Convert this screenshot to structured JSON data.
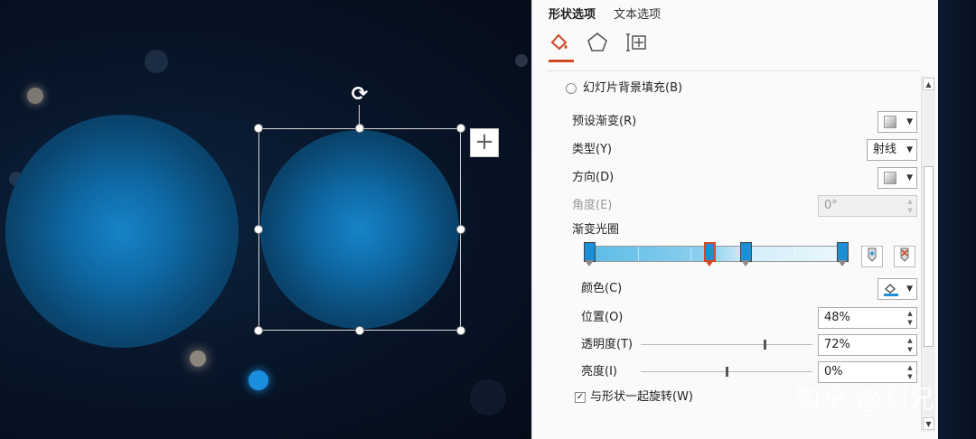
{
  "panel": {
    "tabs": [
      {
        "label": "形状选项",
        "active": true
      },
      {
        "label": "文本选项",
        "active": false
      }
    ],
    "icons": [
      "fill-bucket-icon",
      "pentagon-icon",
      "size-properties-icon"
    ],
    "slide_bg_fill_label": "幻灯片背景填充(B)",
    "preset_gradient_label": "预设渐变(R)",
    "type_label": "类型(Y)",
    "type_value": "射线",
    "direction_label": "方向(D)",
    "angle_label": "角度(E)",
    "angle_value": "0°",
    "gradient_stops_label": "渐变光圈",
    "gradient_stops": [
      0.02,
      0.48,
      0.62,
      0.99
    ],
    "selected_stop_index": 1,
    "color_label": "颜色(C)",
    "position_label": "位置(O)",
    "position_value": "48%",
    "transparency_label": "透明度(T)",
    "transparency_value": "72%",
    "transparency_level": 0.72,
    "brightness_label": "亮度(I)",
    "brightness_value": "0%",
    "brightness_level": 0.5,
    "rotate_with_shape_label": "与形状一起旋转(W)",
    "rotate_with_shape_checked": true
  },
  "canvas": {
    "add_button_glyph": "+",
    "rotate_glyph": "⟳"
  },
  "watermark": "知乎 @利兄",
  "colors": {
    "accent": "#d24726",
    "stop_fill": "#1a8fd6",
    "canvas_bg": "#08162a"
  }
}
